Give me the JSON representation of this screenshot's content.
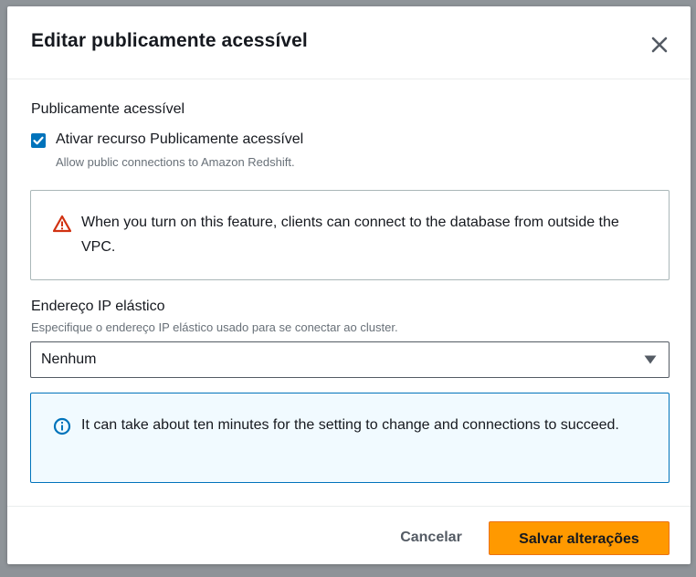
{
  "modal": {
    "title": "Editar publicamente acessível"
  },
  "public_access": {
    "section_label": "Publicamente acessível",
    "checkbox_label": "Ativar recurso Publicamente acessível",
    "checkbox_checked": true,
    "description": "Allow public connections to Amazon Redshift."
  },
  "warning_alert": {
    "text": "When you turn on this feature, clients can connect to the database from outside the VPC.",
    "icon": "warning-icon",
    "color": "#d13212"
  },
  "elastic_ip": {
    "label": "Endereço IP elástico",
    "description": "Especifique o endereço IP elástico usado para se conectar ao cluster.",
    "selected_value": "Nenhum"
  },
  "info_alert": {
    "text": "It can take about ten minutes for the setting to change and connections to succeed.",
    "icon": "info-icon",
    "color": "#0073bb"
  },
  "footer": {
    "cancel_label": "Cancelar",
    "save_label": "Salvar alterações"
  },
  "colors": {
    "accent": "#0073bb",
    "primary_button": "#ff9900"
  }
}
